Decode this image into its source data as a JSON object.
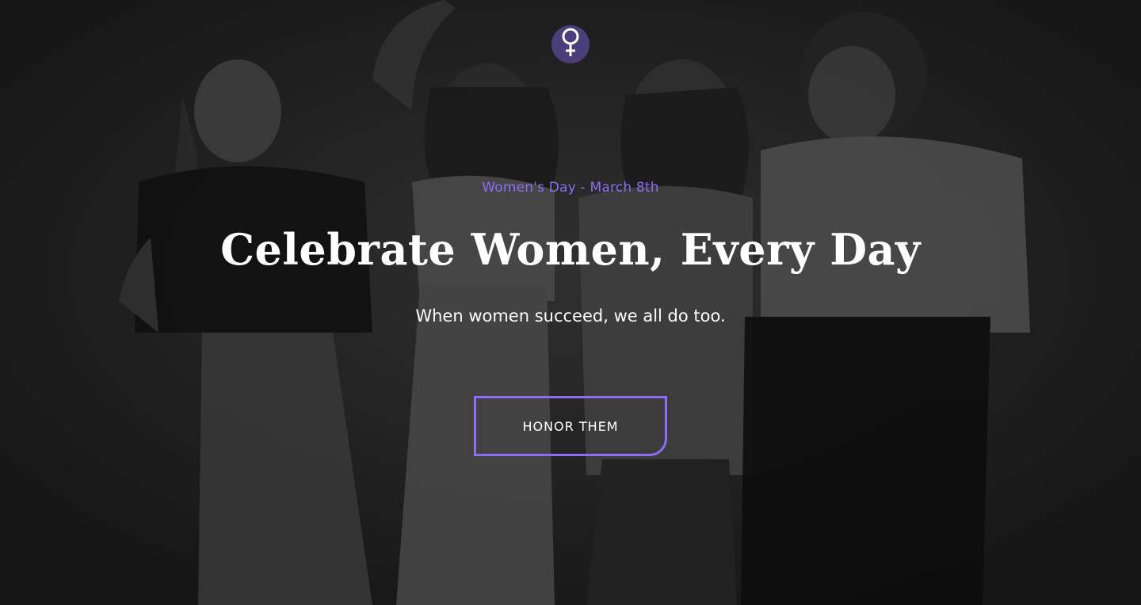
{
  "hero": {
    "eyebrow": "Women's Day - March 8th",
    "title": "Celebrate Women, Every Day",
    "subtitle": "When women succeed, we all do too.",
    "cta_label": "HONOR THEM"
  },
  "logo": {
    "icon": "female-symbol-icon"
  },
  "colors": {
    "accent": "#8c6ef0",
    "logo_bg": "#4a3f7a",
    "text": "#ffffff",
    "background": "#1d1d1d"
  },
  "background_image": {
    "icon": "group-of-women-photo"
  }
}
